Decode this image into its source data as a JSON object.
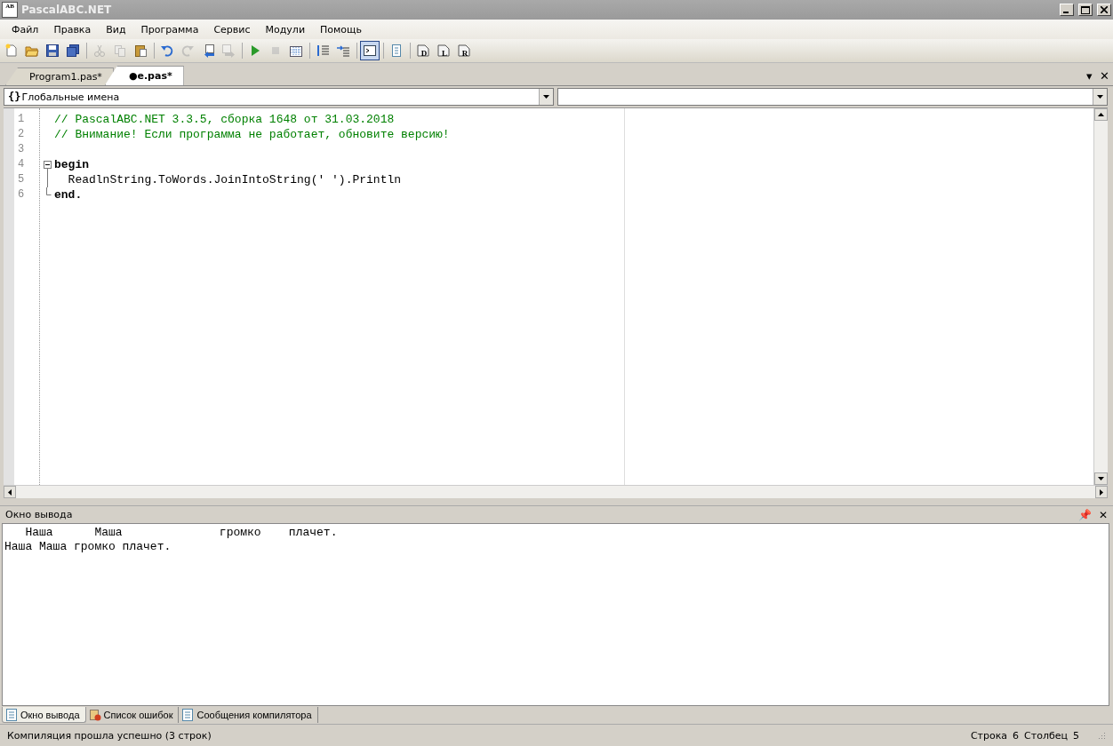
{
  "window": {
    "title": "PascalABC.NET",
    "logo": "AB"
  },
  "menu": [
    {
      "label": "Файл"
    },
    {
      "label": "Правка"
    },
    {
      "label": "Вид"
    },
    {
      "label": "Программа"
    },
    {
      "label": "Сервис"
    },
    {
      "label": "Модули"
    },
    {
      "label": "Помощь"
    }
  ],
  "toolbar": [
    {
      "kind": "button",
      "disabled": false,
      "pressed": false
    },
    {
      "kind": "button",
      "disabled": false,
      "pressed": false
    },
    {
      "kind": "button",
      "disabled": false,
      "pressed": false
    },
    {
      "kind": "button",
      "disabled": false,
      "pressed": false
    },
    {
      "kind": "separator"
    },
    {
      "kind": "button",
      "disabled": true,
      "pressed": false
    },
    {
      "kind": "button",
      "disabled": true,
      "pressed": false
    },
    {
      "kind": "button",
      "disabled": false,
      "pressed": false
    },
    {
      "kind": "separator"
    },
    {
      "kind": "button",
      "disabled": false,
      "pressed": false
    },
    {
      "kind": "button",
      "disabled": true,
      "pressed": false
    },
    {
      "kind": "button",
      "disabled": false,
      "pressed": false
    },
    {
      "kind": "button",
      "disabled": true,
      "pressed": false
    },
    {
      "kind": "separator"
    },
    {
      "kind": "button",
      "disabled": false,
      "pressed": false
    },
    {
      "kind": "button",
      "disabled": true,
      "pressed": false
    },
    {
      "kind": "button",
      "disabled": false,
      "pressed": false
    },
    {
      "kind": "separator"
    },
    {
      "kind": "button",
      "disabled": false,
      "pressed": false
    },
    {
      "kind": "button",
      "disabled": false,
      "pressed": false
    },
    {
      "kind": "separator"
    },
    {
      "kind": "button",
      "disabled": false,
      "pressed": true
    },
    {
      "kind": "separator"
    },
    {
      "kind": "button",
      "disabled": false,
      "pressed": false
    },
    {
      "kind": "separator"
    },
    {
      "kind": "button",
      "disabled": false,
      "pressed": false,
      "label": "D"
    },
    {
      "kind": "button",
      "disabled": false,
      "pressed": false,
      "label": "L"
    },
    {
      "kind": "button",
      "disabled": false,
      "pressed": false,
      "label": "R"
    }
  ],
  "tabs": [
    {
      "label": "Program1.pas*",
      "selected": false
    },
    {
      "label": "●e.pas*",
      "selected": true
    }
  ],
  "tab_controls": {
    "dropdown": "▾",
    "close": "✕"
  },
  "scope_combo": {
    "icon_text": "{}",
    "value": "Глобальные имена"
  },
  "editor": {
    "lines": [
      {
        "number": "1",
        "kind": "comment",
        "text": "// PascalABC.NET 3.3.5, сборка 1648 от 31.03.2018",
        "fold_start": false,
        "fold_inside": false,
        "fold_end": false
      },
      {
        "number": "2",
        "kind": "comment",
        "text": "// Внимание! Если программа не работает, обновите версию!",
        "fold_start": false,
        "fold_inside": false,
        "fold_end": false
      },
      {
        "number": "3",
        "fold_start": false,
        "fold_inside": false,
        "fold_end": false
      },
      {
        "number": "4",
        "kind": "keyword",
        "text": "begin",
        "fold_start": true,
        "fold_inside": false,
        "fold_end": false
      },
      {
        "number": "5",
        "kind": "code",
        "text": "  ReadlnString.ToWords.JoinIntoString(' ').Println",
        "fold_start": false,
        "fold_inside": true,
        "fold_end": false
      },
      {
        "number": "6",
        "kind": "keyword",
        "text": "end.",
        "fold_start": false,
        "fold_inside": false,
        "fold_end": true
      }
    ]
  },
  "output_panel": {
    "title": "Окно вывода",
    "pin": "📌",
    "close": "✕",
    "lines": [
      "   Наша      Маша              громко    плачет.",
      "Наша Маша громко плачет."
    ]
  },
  "bottom_tabs": [
    {
      "label": "Окно вывода",
      "selected": true
    },
    {
      "label": "Список ошибок",
      "selected": false
    },
    {
      "label": "Сообщения компилятора",
      "selected": false
    }
  ],
  "status_bar": {
    "message": "Компиляция прошла успешно (3 строк)",
    "row_label": "Строка",
    "row": "6",
    "col_label": "Столбец",
    "col": "5"
  }
}
